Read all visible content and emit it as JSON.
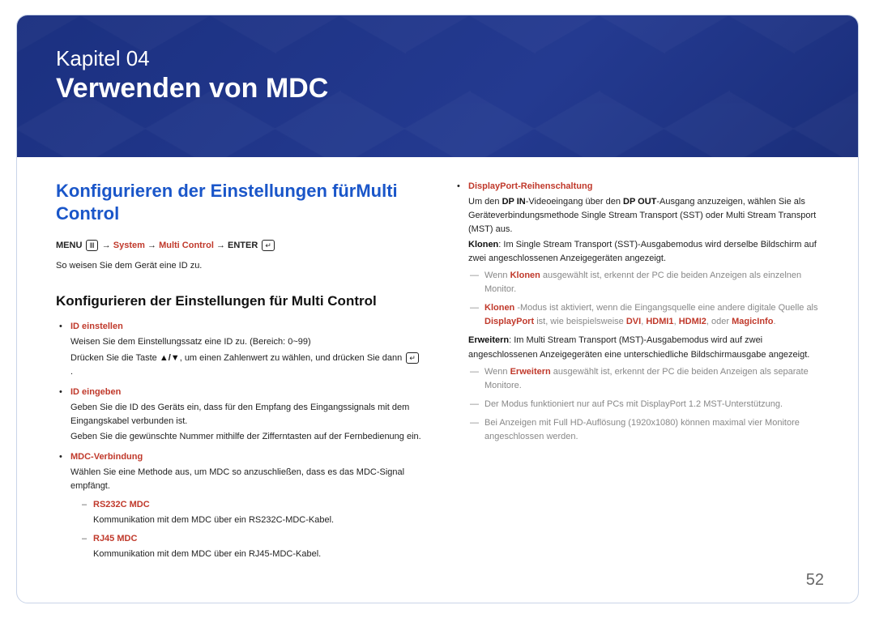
{
  "chapter": {
    "label": "Kapitel 04",
    "title": "Verwenden von MDC"
  },
  "section_heading": "Konfigurieren der Einstellungen fürMulti Control",
  "path": {
    "menu": "MENU",
    "system": "System",
    "multi": "Multi Control",
    "enter": "ENTER",
    "arrow": "→"
  },
  "intro": "So weisen Sie dem Gerät eine ID zu.",
  "sub_heading": "Konfigurieren der Einstellungen für Multi Control",
  "left": {
    "id_einstellen": {
      "term": "ID einstellen",
      "line1": "Weisen Sie dem Einstellungssatz eine ID zu. (Bereich: 0~99)",
      "line2_a": "Drücken Sie die Taste ",
      "line2_b": ", um einen Zahlenwert zu wählen, und drücken Sie dann ",
      "line2_c": "."
    },
    "id_eingeben": {
      "term": "ID eingeben",
      "line1": "Geben Sie die ID des Geräts ein, dass für den Empfang des Eingangssignals mit dem Eingangskabel verbunden ist.",
      "line2": "Geben Sie die gewünschte Nummer mithilfe der Zifferntasten auf der Fernbedienung ein."
    },
    "mdc": {
      "term": "MDC-Verbindung",
      "line1": "Wählen Sie eine Methode aus, um MDC so anzuschließen, dass es das MDC-Signal empfängt.",
      "rs232c": {
        "term": "RS232C MDC",
        "desc": "Kommunikation mit dem MDC über ein RS232C-MDC-Kabel."
      },
      "rj45": {
        "term": "RJ45 MDC",
        "desc": "Kommunikation mit dem MDC über ein RJ45-MDC-Kabel."
      }
    }
  },
  "right": {
    "dp": {
      "term": "DisplayPort-Reihenschaltung",
      "line1_a": "Um den ",
      "dp_in": "DP IN",
      "line1_b": "-Videoeingang über den ",
      "dp_out": "DP OUT",
      "line1_c": "-Ausgang anzuzeigen, wählen Sie als Geräteverbindungsmethode Single Stream Transport (SST) oder Multi Stream Transport (MST) aus.",
      "klonen_term": "Klonen",
      "klonen_desc": ": Im Single Stream Transport (SST)-Ausgabemodus wird derselbe Bildschirm auf zwei angeschlossenen Anzeigegeräten angezeigt.",
      "note1_a": "Wenn ",
      "note1_b": " ausgewählt ist, erkennt der PC die beiden Anzeigen als einzelnen Monitor.",
      "note2_a": " -Modus ist aktiviert, wenn die Eingangsquelle eine andere digitale Quelle als ",
      "displayport": "DisplayPort",
      "note2_b": " ist, wie beispielsweise ",
      "dvi": "DVI",
      "hdmi1": "HDMI1",
      "hdmi2": "HDMI2",
      "oder": ", oder ",
      "magicinfo": "MagicInfo",
      "erweitern_term": "Erweitern",
      "erweitern_desc": ": Im Multi Stream Transport (MST)-Ausgabemodus wird auf zwei angeschlossenen Anzeigegeräten eine unterschiedliche Bildschirmausgabe angezeigt.",
      "note3_a": "Wenn ",
      "note3_b": " ausgewählt ist, erkennt der PC die beiden Anzeigen als separate Monitore.",
      "note4": "Der Modus funktioniert nur auf PCs mit DisplayPort 1.2 MST-Unterstützung.",
      "note5": "Bei Anzeigen mit Full HD-Auflösung (1920x1080) können maximal vier Monitore angeschlossen werden."
    }
  },
  "page_number": "52"
}
